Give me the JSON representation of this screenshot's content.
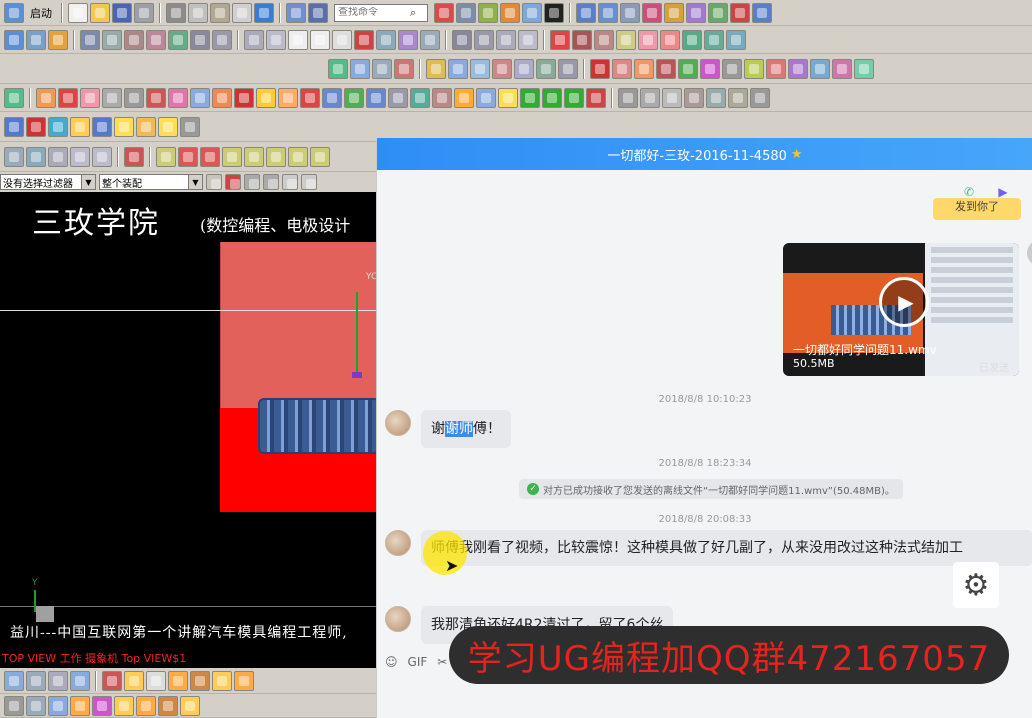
{
  "toolbar": {
    "start_label": "启动",
    "search_placeholder": "查找命令",
    "filter_select": "没有选择过滤器",
    "assembly_select": "整个装配"
  },
  "viewport": {
    "brand_title": "三玫学院",
    "brand_subtitle": "(数控编程、电极设计",
    "axis_label": "YC",
    "triad_y_label": "Y",
    "bottom_caption": "益川---中国互联网第一个讲解汽车模具编程工程师,",
    "view_label": "TOP VIEW 工作 摄象机 Top VIEW$1"
  },
  "chat": {
    "title": "一切都好-三玫-2016-11-4580",
    "star_icon": "star-icon",
    "top_bubble_text": "发到你了",
    "video": {
      "file_name": "一切都好同学问题11.wmv",
      "file_size": "50.5MB",
      "status": "已发送"
    },
    "timestamps": [
      "2018/8/8 10:10:23",
      "2018/8/8 18:23:34",
      "2018/8/8 20:08:33"
    ],
    "messages": [
      {
        "pre": "谢",
        "highlight": "谢师",
        "post": "傅！"
      },
      {
        "text": "师傅我刚看了视频，比较震惊！这种模具做了好几副了，从来没用改过这种法式结加工"
      },
      {
        "text": "我那清角还好4R2清过了，留了6个丝"
      }
    ],
    "system_note": "对方已成功接收了您发送的离线文件“一切都好同学问题11.wmv”(50.48MB)。",
    "input_icons": [
      "smiley-icon",
      "GIF",
      "scissors-icon"
    ],
    "promo_text": "学习UG编程加QQ群472167057"
  },
  "colors": {
    "header_blue": "#2f8df7",
    "promo_red": "#e8221d",
    "part_red": "#e2615a",
    "thread_blue": "#3a5c92"
  }
}
